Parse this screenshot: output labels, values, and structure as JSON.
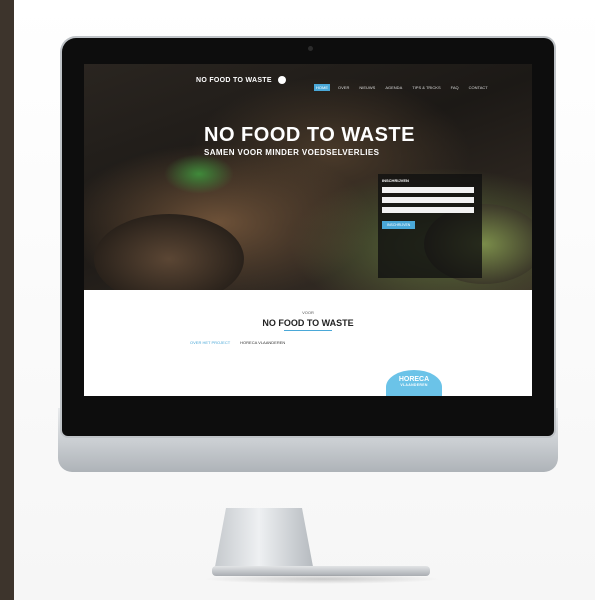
{
  "site": {
    "logo_text": "NO FOOD TO WASTE",
    "nav": [
      {
        "label": "HOME",
        "active": true
      },
      {
        "label": "OVER",
        "active": false
      },
      {
        "label": "NIEUWS",
        "active": false
      },
      {
        "label": "AGENDA",
        "active": false
      },
      {
        "label": "TIPS & TRICKS",
        "active": false
      },
      {
        "label": "FAQ",
        "active": false
      },
      {
        "label": "CONTACT",
        "active": false
      }
    ],
    "hero": {
      "headline": "NO FOOD TO WASTE",
      "subhead": "SAMEN VOOR MINDER VOEDSELVERLIES"
    },
    "form": {
      "title": "INSCHRIJVEN",
      "button": "INSCHRIJVEN"
    },
    "content": {
      "kicker": "VOOR",
      "title": "NO FOOD TO WASTE",
      "tabs": [
        "OVER HET PROJECT",
        "HORECA VLAANDEREN"
      ],
      "badge_top": "HORECA",
      "badge_bottom": "VLAANDEREN"
    }
  },
  "colors": {
    "accent": "#4aa8d8",
    "badge": "#6bc3e8"
  }
}
